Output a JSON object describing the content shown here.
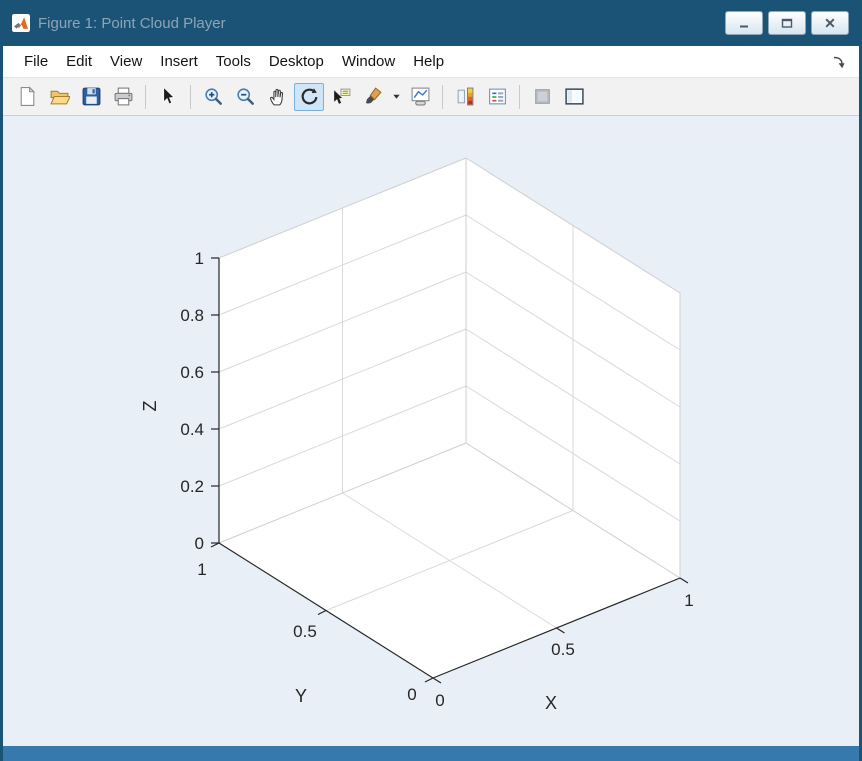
{
  "window": {
    "title": "Figure 1: Point Cloud Player",
    "controls": [
      "minimize",
      "maximize",
      "close"
    ]
  },
  "menu": {
    "items": [
      "File",
      "Edit",
      "View",
      "Insert",
      "Tools",
      "Desktop",
      "Window",
      "Help"
    ]
  },
  "toolbar": {
    "items": [
      "new-figure",
      "open-file",
      "save-figure",
      "print-figure",
      "edit-plot",
      "zoom-in",
      "zoom-out",
      "pan",
      "rotate-3d",
      "data-cursor",
      "brush-select-data",
      "link-plot",
      "insert-colorbar",
      "insert-legend",
      "hide-plot-tools",
      "show-plot-tools"
    ],
    "selected": "rotate-3d"
  },
  "icons": {
    "matlab-logo": "orange-triangle-logo",
    "minimize": "horizontal-bar",
    "maximize": "rectangle-outline",
    "close": "x-cross",
    "dock-figure": "curved-arrow-down-right",
    "new-figure": "blank-page",
    "open-file": "open-folder",
    "save-figure": "floppy-disk",
    "print-figure": "printer",
    "edit-plot": "arrow-cursor",
    "zoom-in": "magnifier-plus",
    "zoom-out": "magnifier-minus",
    "pan": "hand",
    "rotate-3d": "circular-arrow",
    "data-cursor": "cursor-with-tooltip",
    "brush-select-data": "paintbrush",
    "brush-dropdown": "caret-down",
    "link-plot": "chart-with-link",
    "insert-colorbar": "vertical-colorbar",
    "insert-legend": "legend-box",
    "hide-plot-tools": "gray-square",
    "show-plot-tools": "window-with-panels"
  },
  "plot": {
    "type": "empty-3d-axes",
    "x_label": "X",
    "y_label": "Y",
    "z_label": "Z",
    "x_ticks": [
      "0",
      "0.5",
      "1"
    ],
    "y_ticks": [
      "1",
      "0.5",
      "0"
    ],
    "z_ticks": [
      "1",
      "0.8",
      "0.6",
      "0.4",
      "0.2",
      "0"
    ],
    "x_range": [
      0,
      1
    ],
    "y_range": [
      0,
      1
    ],
    "z_range": [
      0,
      1
    ],
    "grid": "on",
    "view": "default 3-D (az -37.5, el 30)"
  },
  "colors": {
    "titlebar": "#1b5377",
    "title_text": "#8fa4b5",
    "canvas_background": "#e9eff7",
    "axes_walls": "#ffffff",
    "grid_line": "#d9d9d9",
    "axis_line": "#262626",
    "selected_tool_bg": "#cee6f7",
    "selected_tool_border": "#7ab2dd",
    "bottom_frame": "#3579ad"
  }
}
